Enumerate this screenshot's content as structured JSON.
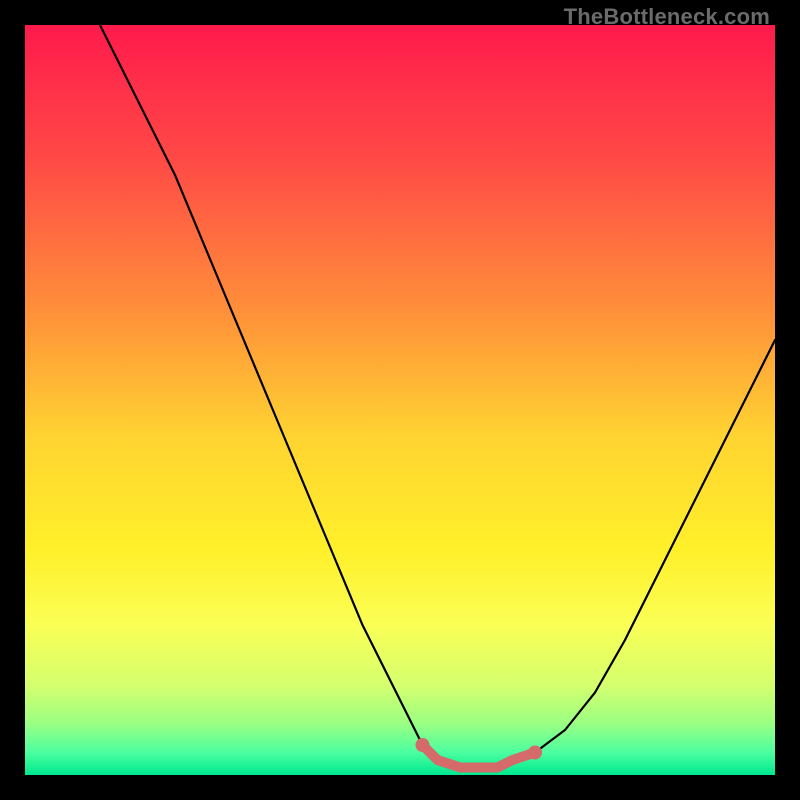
{
  "watermark": "TheBottleneck.com",
  "colors": {
    "frame": "#000000",
    "curve": "#000000",
    "marker": "#d46a6a",
    "gradient_stops": [
      {
        "offset": 0.0,
        "color": "#ff1a4c"
      },
      {
        "offset": 0.18,
        "color": "#ff4a46"
      },
      {
        "offset": 0.38,
        "color": "#ff8f3a"
      },
      {
        "offset": 0.55,
        "color": "#ffd431"
      },
      {
        "offset": 0.7,
        "color": "#fff02a"
      },
      {
        "offset": 0.8,
        "color": "#faff55"
      },
      {
        "offset": 0.88,
        "color": "#d4ff6e"
      },
      {
        "offset": 0.93,
        "color": "#9dff82"
      },
      {
        "offset": 0.97,
        "color": "#4bffa0"
      },
      {
        "offset": 1.0,
        "color": "#00e890"
      }
    ]
  },
  "chart_data": {
    "type": "line",
    "title": "",
    "xlabel": "",
    "ylabel": "",
    "xlim": [
      0,
      100
    ],
    "ylim": [
      0,
      100
    ],
    "grid": false,
    "series": [
      {
        "name": "bottleneck-curve",
        "x": [
          10,
          15,
          20,
          25,
          30,
          35,
          40,
          45,
          50,
          53,
          55,
          58,
          60,
          63,
          65,
          68,
          72,
          76,
          80,
          85,
          90,
          95,
          100
        ],
        "y": [
          100,
          90,
          80,
          68,
          56,
          44,
          32,
          20,
          10,
          4,
          2,
          1,
          1,
          1,
          2,
          3,
          6,
          11,
          18,
          28,
          38,
          48,
          58
        ]
      }
    ],
    "markers": {
      "name": "highlighted-range",
      "x": [
        53,
        55,
        58,
        60,
        63,
        65,
        68
      ],
      "y": [
        4,
        2,
        1,
        1,
        1,
        2,
        3
      ]
    }
  }
}
